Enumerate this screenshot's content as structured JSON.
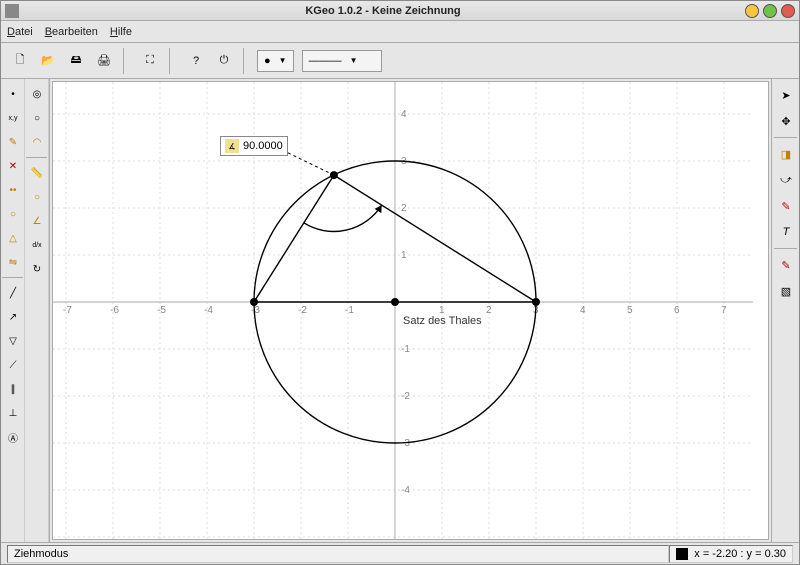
{
  "title": "KGeo 1.0.2 - Keine Zeichnung",
  "menu": {
    "file": "Datei",
    "edit": "Bearbeiten",
    "help": "Hilfe"
  },
  "status": {
    "mode": "Ziehmodus",
    "coords": "x = -2.20 : y = 0.30"
  },
  "angle_label": "90.0000",
  "canvas_text": "Satz des Thales",
  "axes": {
    "x_ticks": [
      -7,
      -6,
      -5,
      -4,
      -3,
      -2,
      -1,
      1,
      2,
      3,
      4,
      5,
      6,
      7
    ],
    "y_ticks": [
      -4,
      -3,
      -2,
      -1,
      1,
      2,
      3,
      4
    ]
  },
  "geometry": {
    "circle": {
      "cx": 0,
      "cy": 0,
      "r": 3
    },
    "points": {
      "A": [
        -3,
        0
      ],
      "B": [
        3,
        0
      ],
      "C": [
        -1.3,
        2.7
      ],
      "M": [
        0,
        0
      ]
    },
    "angle_arc_radius": 1.2
  },
  "dropdowns": {
    "point_style": "●",
    "line_style": "———"
  }
}
